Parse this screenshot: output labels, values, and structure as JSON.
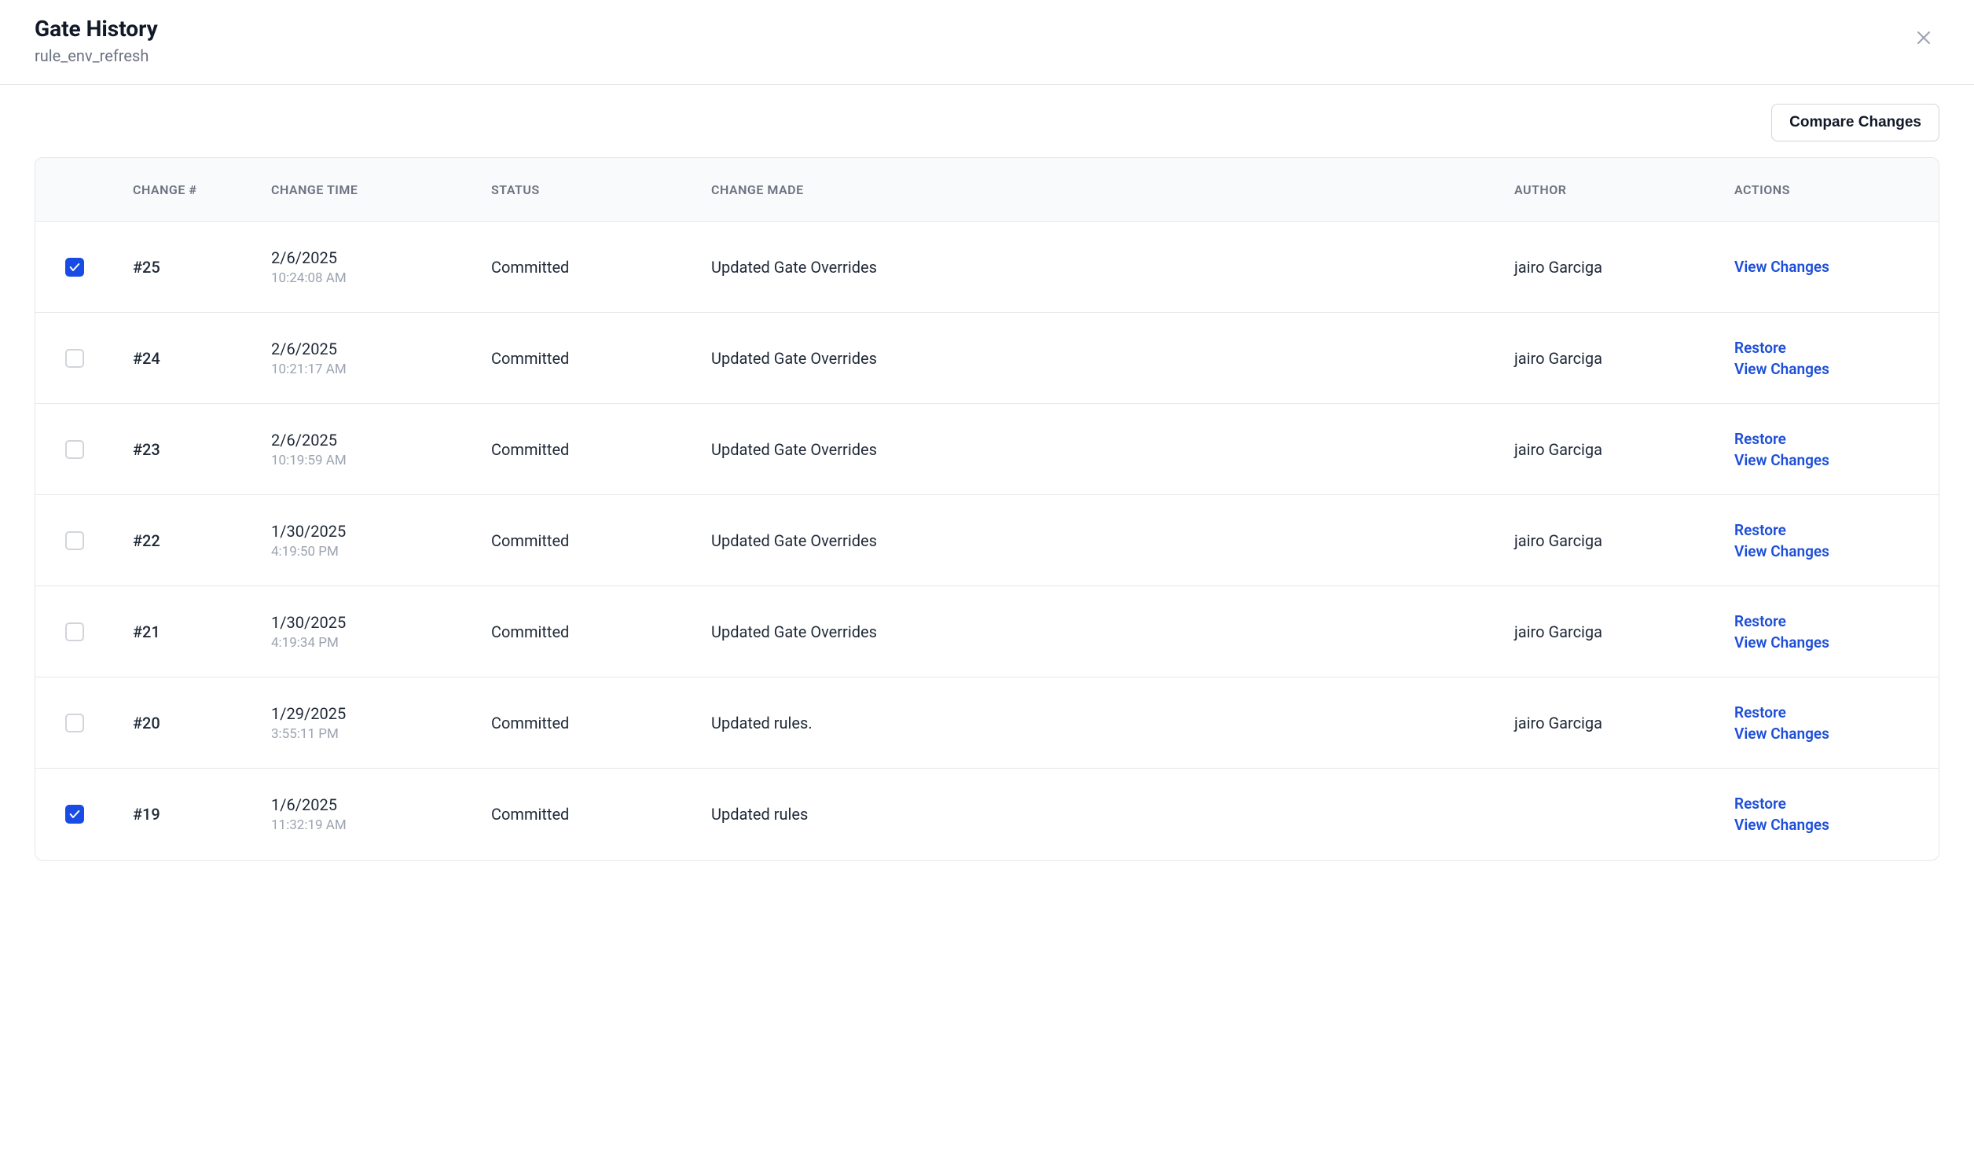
{
  "header": {
    "title": "Gate History",
    "subtitle": "rule_env_refresh"
  },
  "toolbar": {
    "compare_label": "Compare Changes"
  },
  "table": {
    "columns": {
      "change_num": "CHANGE #",
      "change_time": "CHANGE TIME",
      "status": "STATUS",
      "change_made": "CHANGE MADE",
      "author": "AUTHOR",
      "actions": "ACTIONS"
    },
    "actions_labels": {
      "restore": "Restore",
      "view_changes": "View Changes"
    },
    "rows": [
      {
        "checked": true,
        "change_num": "#25",
        "date": "2/6/2025",
        "time": "10:24:08 AM",
        "status": "Committed",
        "change_made": "Updated Gate Overrides",
        "author": "jairo Garciga",
        "show_restore": false
      },
      {
        "checked": false,
        "change_num": "#24",
        "date": "2/6/2025",
        "time": "10:21:17 AM",
        "status": "Committed",
        "change_made": "Updated Gate Overrides",
        "author": "jairo Garciga",
        "show_restore": true
      },
      {
        "checked": false,
        "change_num": "#23",
        "date": "2/6/2025",
        "time": "10:19:59 AM",
        "status": "Committed",
        "change_made": "Updated Gate Overrides",
        "author": "jairo Garciga",
        "show_restore": true
      },
      {
        "checked": false,
        "change_num": "#22",
        "date": "1/30/2025",
        "time": "4:19:50 PM",
        "status": "Committed",
        "change_made": "Updated Gate Overrides",
        "author": "jairo Garciga",
        "show_restore": true
      },
      {
        "checked": false,
        "change_num": "#21",
        "date": "1/30/2025",
        "time": "4:19:34 PM",
        "status": "Committed",
        "change_made": "Updated Gate Overrides",
        "author": "jairo Garciga",
        "show_restore": true
      },
      {
        "checked": false,
        "change_num": "#20",
        "date": "1/29/2025",
        "time": "3:55:11 PM",
        "status": "Committed",
        "change_made": "Updated rules.",
        "author": "jairo Garciga",
        "show_restore": true
      },
      {
        "checked": true,
        "change_num": "#19",
        "date": "1/6/2025",
        "time": "11:32:19 AM",
        "status": "Committed",
        "change_made": "Updated rules",
        "author": "",
        "show_restore": true
      }
    ]
  }
}
